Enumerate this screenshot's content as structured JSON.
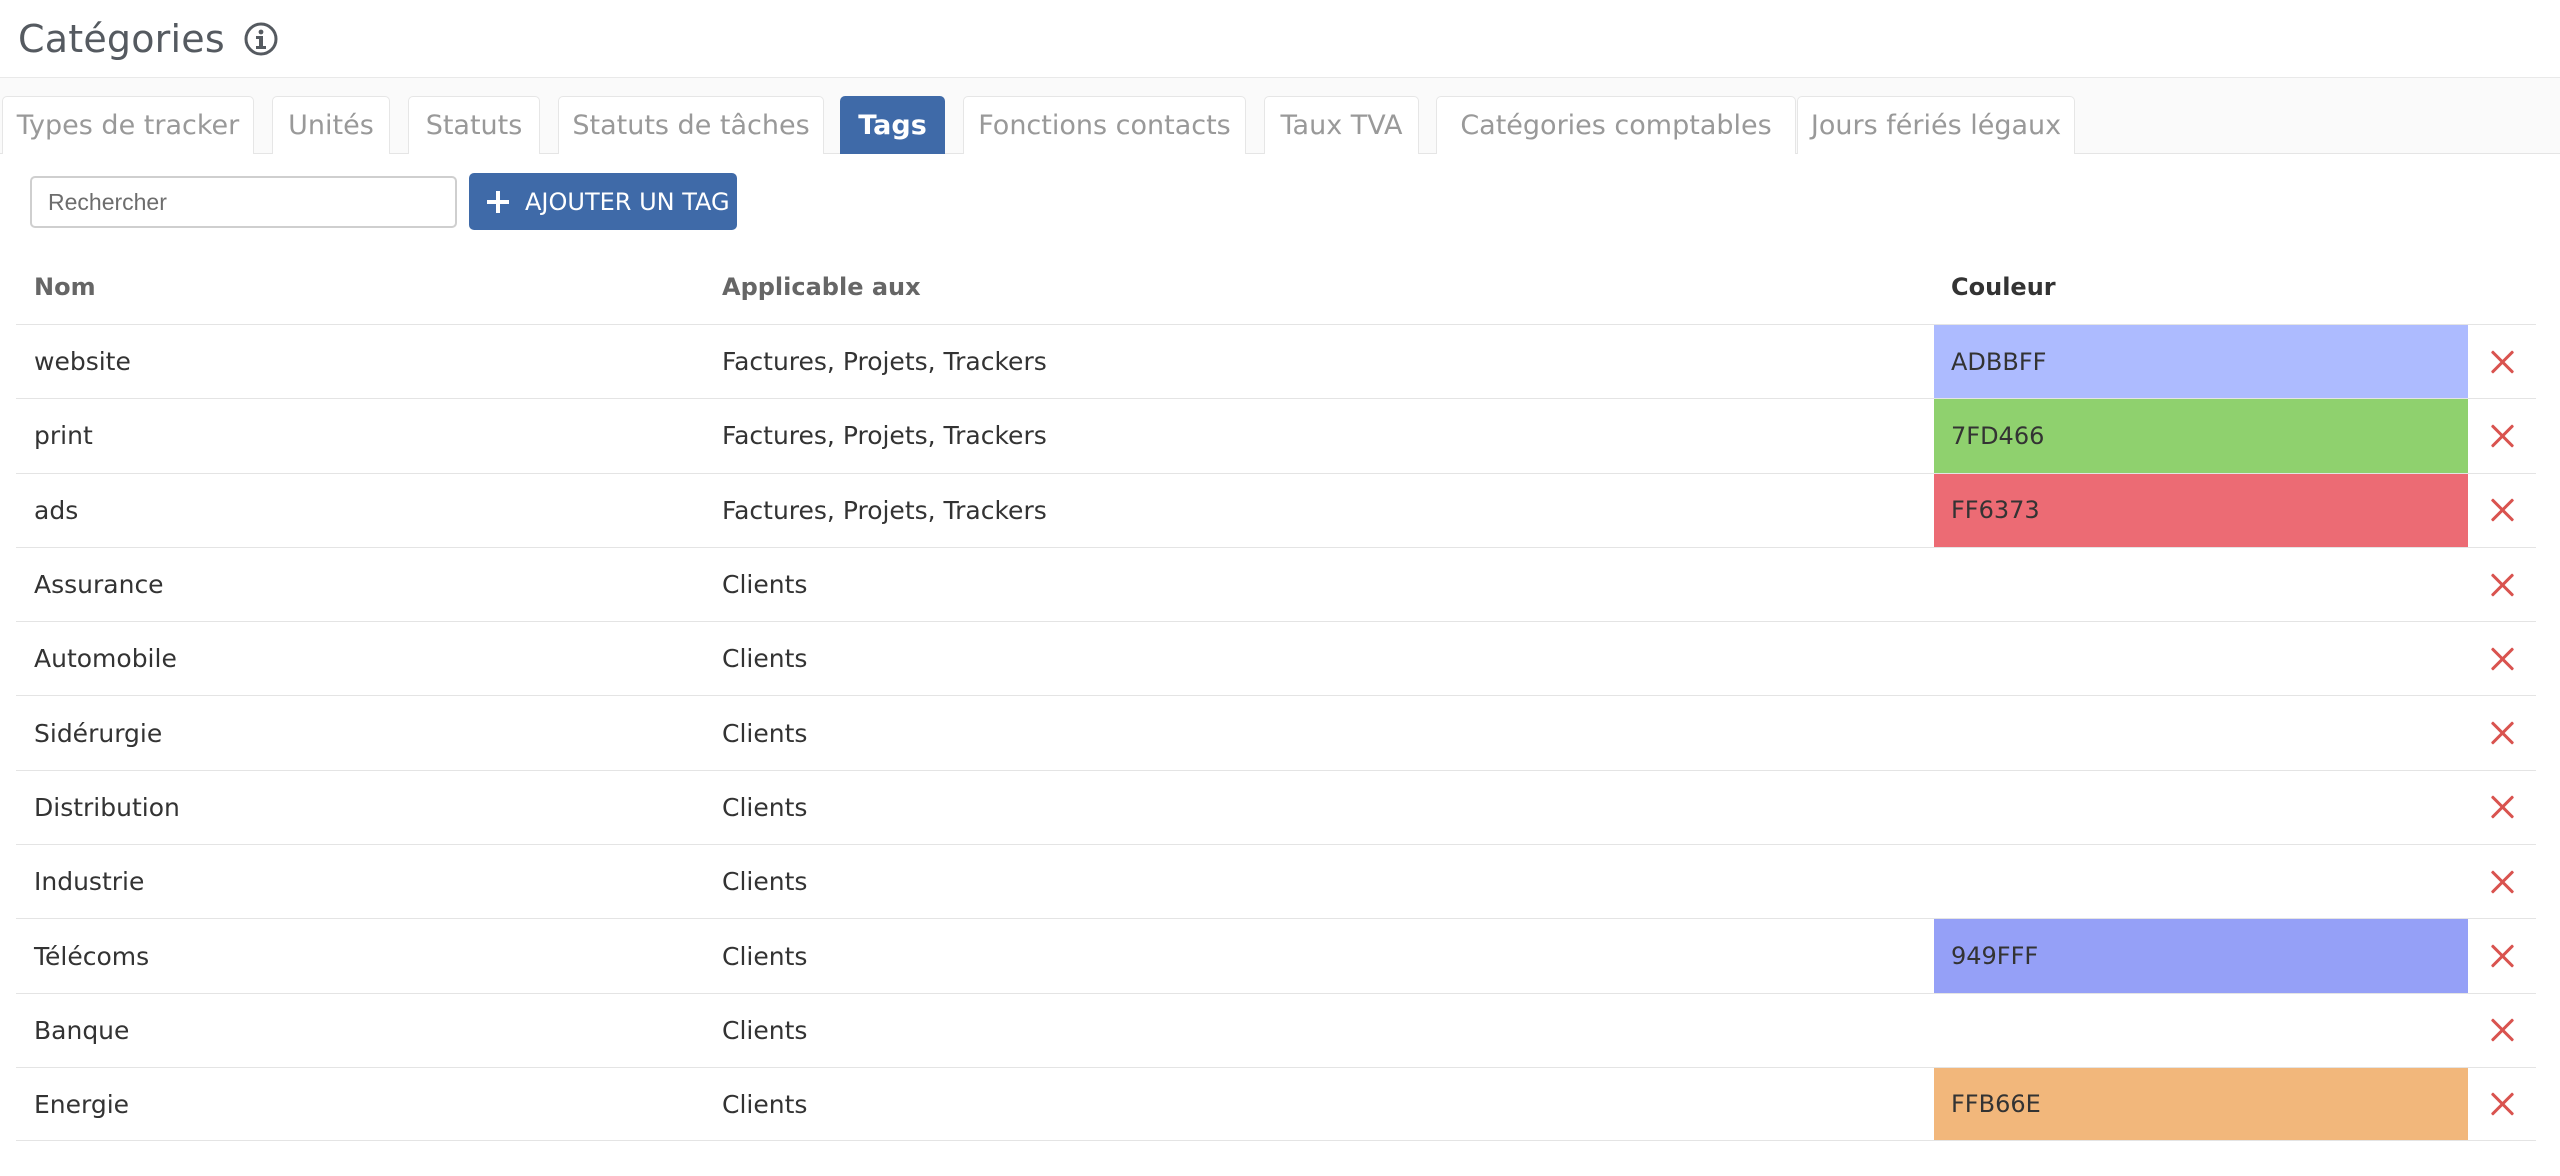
{
  "header": {
    "title": "Catégories",
    "info_icon": "info-circle-icon"
  },
  "tabs": [
    {
      "label": "Types de tracker",
      "active": false
    },
    {
      "label": "Unités",
      "active": false
    },
    {
      "label": "Statuts",
      "active": false
    },
    {
      "label": "Statuts de tâches",
      "active": false
    },
    {
      "label": "Tags",
      "active": true
    },
    {
      "label": "Fonctions contacts",
      "active": false
    },
    {
      "label": "Taux TVA",
      "active": false
    },
    {
      "label": "Catégories comptables",
      "active": false
    },
    {
      "label": "Jours fériés légaux",
      "active": false
    }
  ],
  "toolbar": {
    "search_placeholder": "Rechercher",
    "search_value": "",
    "add_label": "AJOUTER UN TAG"
  },
  "table": {
    "headers": {
      "name": "Nom",
      "applicable": "Applicable aux",
      "color": "Couleur"
    },
    "rows": [
      {
        "name": "website",
        "applicable": "Factures, Projets, Trackers",
        "color": "ADBBFF",
        "color_hex": "#ADBBFF"
      },
      {
        "name": "print",
        "applicable": "Factures, Projets, Trackers",
        "color": "7FD466",
        "color_hex": "#8FD16E"
      },
      {
        "name": "ads",
        "applicable": "Factures, Projets, Trackers",
        "color": "FF6373",
        "color_hex": "#EC6B74"
      },
      {
        "name": "Assurance",
        "applicable": "Clients",
        "color": "",
        "color_hex": ""
      },
      {
        "name": "Automobile",
        "applicable": "Clients",
        "color": "",
        "color_hex": ""
      },
      {
        "name": "Sidérurgie",
        "applicable": "Clients",
        "color": "",
        "color_hex": ""
      },
      {
        "name": "Distribution",
        "applicable": "Clients",
        "color": "",
        "color_hex": ""
      },
      {
        "name": "Industrie",
        "applicable": "Clients",
        "color": "",
        "color_hex": ""
      },
      {
        "name": "Télécoms",
        "applicable": "Clients",
        "color": "949FFF",
        "color_hex": "#95A0F7"
      },
      {
        "name": "Banque",
        "applicable": "Clients",
        "color": "",
        "color_hex": ""
      },
      {
        "name": "Energie",
        "applicable": "Clients",
        "color": "FFB66E",
        "color_hex": "#F2B77B"
      }
    ]
  },
  "colors": {
    "accent": "#3F6AA8",
    "delete": "#D9534F"
  }
}
